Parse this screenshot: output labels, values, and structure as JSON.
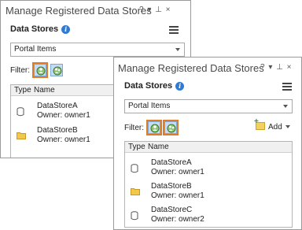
{
  "back_pane": {
    "title": "Manage Registered Data Stores",
    "window_controls": "?  ▾  ⊥  ×",
    "section_title": "Data Stores",
    "dropdown_value": "Portal Items",
    "filter_label": "Filter:",
    "columns": [
      "Type",
      "Name"
    ],
    "items": [
      {
        "name": "DataStoreA",
        "owner": "Owner:  owner1",
        "icon": "database-icon"
      },
      {
        "name": "DataStoreB",
        "owner": "Owner:  owner1",
        "icon": "folder-icon"
      }
    ]
  },
  "front_pane": {
    "title": "Manage Registered Data Stores",
    "window_controls": "?  ▾  ⊥  ×",
    "section_title": "Data Stores",
    "dropdown_value": "Portal Items",
    "filter_label": "Filter:",
    "add_label": "Add",
    "columns": [
      "Type",
      "Name"
    ],
    "items": [
      {
        "name": "DataStoreA",
        "owner": "Owner:  owner1",
        "icon": "database-icon"
      },
      {
        "name": "DataStoreB",
        "owner": "Owner:  owner1",
        "icon": "folder-icon"
      },
      {
        "name": "DataStoreC",
        "owner": "Owner:  owner2",
        "icon": "database-icon"
      }
    ]
  },
  "colors": {
    "highlight": "#e07b27",
    "info": "#2f7bd3",
    "folder": "#f2c84b",
    "filter_button": "#c5dcf4"
  }
}
